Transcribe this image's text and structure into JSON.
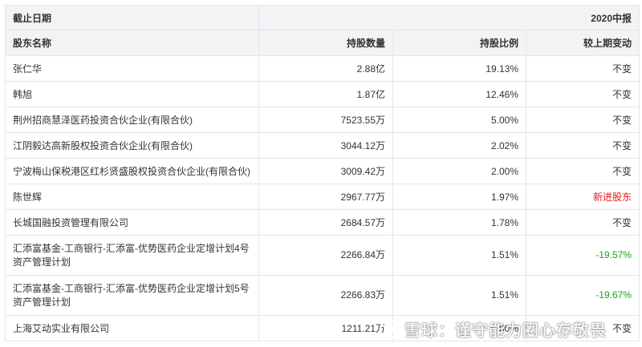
{
  "period_label": "截止日期",
  "period_value": "2020中报",
  "headers": {
    "name": "股东名称",
    "shares": "持股数量",
    "ratio": "持股比例",
    "change": "较上期变动"
  },
  "rows": [
    {
      "name": "张仁华",
      "shares": "2.88亿",
      "ratio": "19.13%",
      "change": "不变",
      "change_type": "same"
    },
    {
      "name": "韩旭",
      "shares": "1.87亿",
      "ratio": "12.46%",
      "change": "不变",
      "change_type": "same"
    },
    {
      "name": "荆州招商慧泽医药投资合伙企业(有限合伙)",
      "shares": "7523.55万",
      "ratio": "5.00%",
      "change": "不变",
      "change_type": "same"
    },
    {
      "name": "江阴毅达高新股权投资合伙企业(有限合伙)",
      "shares": "3044.12万",
      "ratio": "2.02%",
      "change": "不变",
      "change_type": "same"
    },
    {
      "name": "宁波梅山保税港区红杉贤盛股权投资合伙企业(有限合伙)",
      "shares": "3009.42万",
      "ratio": "2.00%",
      "change": "不变",
      "change_type": "same"
    },
    {
      "name": "陈世辉",
      "shares": "2967.77万",
      "ratio": "1.97%",
      "change": "新进股东",
      "change_type": "new"
    },
    {
      "name": "长城国融投资管理有限公司",
      "shares": "2684.57万",
      "ratio": "1.78%",
      "change": "不变",
      "change_type": "same"
    },
    {
      "name": "汇添富基金-工商银行-汇添富-优势医药企业定增计划4号资产管理计划",
      "shares": "2266.84万",
      "ratio": "1.51%",
      "change": "-19.57%",
      "change_type": "down"
    },
    {
      "name": "汇添富基金-工商银行-汇添富-优势医药企业定增计划5号资产管理计划",
      "shares": "2266.83万",
      "ratio": "1.51%",
      "change": "-19.67%",
      "change_type": "down"
    },
    {
      "name": "上海艾动实业有限公司",
      "shares": "1211.21万",
      "ratio": "0.80%",
      "change": "不变",
      "change_type": "same"
    }
  ],
  "watermark": "雪球：谨守能力圈心存敬畏",
  "colors": {
    "header_bg": "#f2f3f5",
    "border": "#e3e6ea",
    "text": "#333333",
    "increase_new": "#e02020",
    "decrease": "#1aa51a"
  }
}
